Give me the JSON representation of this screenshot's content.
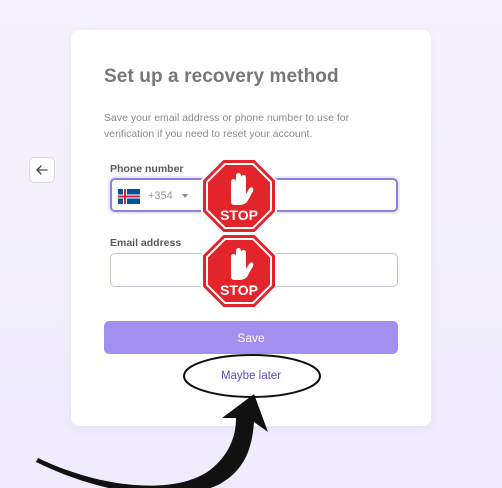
{
  "card": {
    "title": "Set up a recovery method",
    "description": "Save your email address or phone number to use for verification if you need to reset your account."
  },
  "phone": {
    "label": "Phone number",
    "country_flag": "iceland-flag",
    "dial_code": "+354",
    "value": ""
  },
  "email": {
    "label": "Email address",
    "value": ""
  },
  "actions": {
    "save_label": "Save",
    "later_label": "Maybe later"
  },
  "overlays": {
    "stop_sign_text": "STOP"
  },
  "colors": {
    "accent": "#8c7fe0",
    "button": "#a190ef",
    "link": "#5b4bb7",
    "stop_red": "#e3242b"
  }
}
